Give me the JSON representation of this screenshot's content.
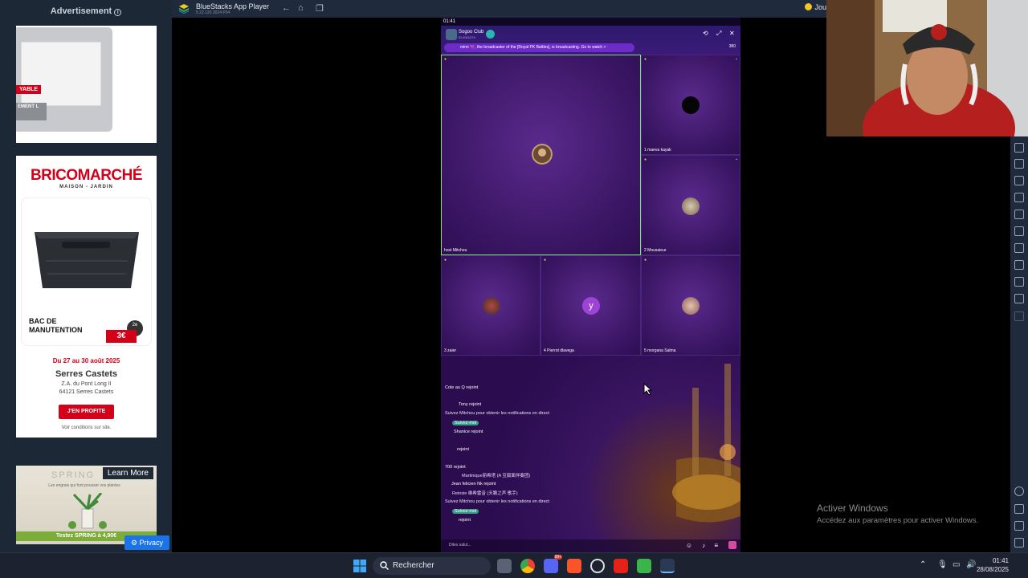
{
  "ads": {
    "header": "Advertisement",
    "info_glyph": "i",
    "ad1": {
      "tag": "YABLE",
      "tag2": "EMENT\nL"
    },
    "brico": {
      "brand": "BRICOMARCHÉ",
      "sub": "MAISON - JARDIN",
      "product": "BAC DE MANUTENTION",
      "price_badge": "2e",
      "price": "3€",
      "dates": "Du 27 au 30 août 2025",
      "store": "Serres Castets",
      "addr1": "Z.A. du Pont Long II",
      "addr2": "64121 Serres Castets",
      "cta": "J'EN PROFITE",
      "conditions": "Voir conditions sur site."
    },
    "spring": {
      "learn_more": "Learn More",
      "brand": "SPRING",
      "text": "Les engrais qui font pousser vos plantes",
      "offer": "Testez SPRING à 4,90€"
    },
    "privacy": "Privacy"
  },
  "bluestacks": {
    "title": "BlueStacks App Player",
    "version": "5.22.120.3024 P64",
    "right_label": "Jou",
    "nav": {
      "back": "←",
      "home": "⌂",
      "multi": "❐"
    }
  },
  "game": {
    "status_time": "01:41",
    "club_name": "Sogoo Club",
    "club_id": "ID:4001074",
    "banner": "mimi 💜, the broadcaster of the [Royal PK Battles], is broadcasting. Go to watch >",
    "online": "380",
    "seats": [
      {
        "num": "host",
        "name": "Mitchou"
      },
      {
        "num": "1",
        "name": "maeva kayak"
      },
      {
        "num": "2",
        "name": "Mousaieur"
      },
      {
        "num": "3",
        "name": "zaier"
      },
      {
        "num": "4",
        "name": "Pierrot dlavega",
        "initial": "y"
      },
      {
        "num": "5",
        "name": "morgana Salma"
      }
    ],
    "chat": [
      "Cole au Q rejoint",
      "Tony rejoint",
      "Suivez Mitchou pour obtenir les notifications en direct",
      "Suivez-moi",
      "Shanice rejoint",
      "rejoint",
      "700 rejoint",
      "Martinique丽希塔 (A 豆腐面伴奏团)",
      "Jean felicien Nk rejoint",
      "Reinsie 维希雷音 (天籁之声 歌手)",
      "Suivez Mitchou pour obtenir les notifications en direct",
      "Suivez-moi",
      "rejoint"
    ],
    "say_placeholder": "Dites salut..."
  },
  "watermark": {
    "line1": "Activer Windows",
    "line2": "Accédez aux paramètres pour activer Windows."
  },
  "taskbar": {
    "search": "Rechercher",
    "time": "01:41",
    "date": "28/08/2025",
    "badge": "99+"
  }
}
